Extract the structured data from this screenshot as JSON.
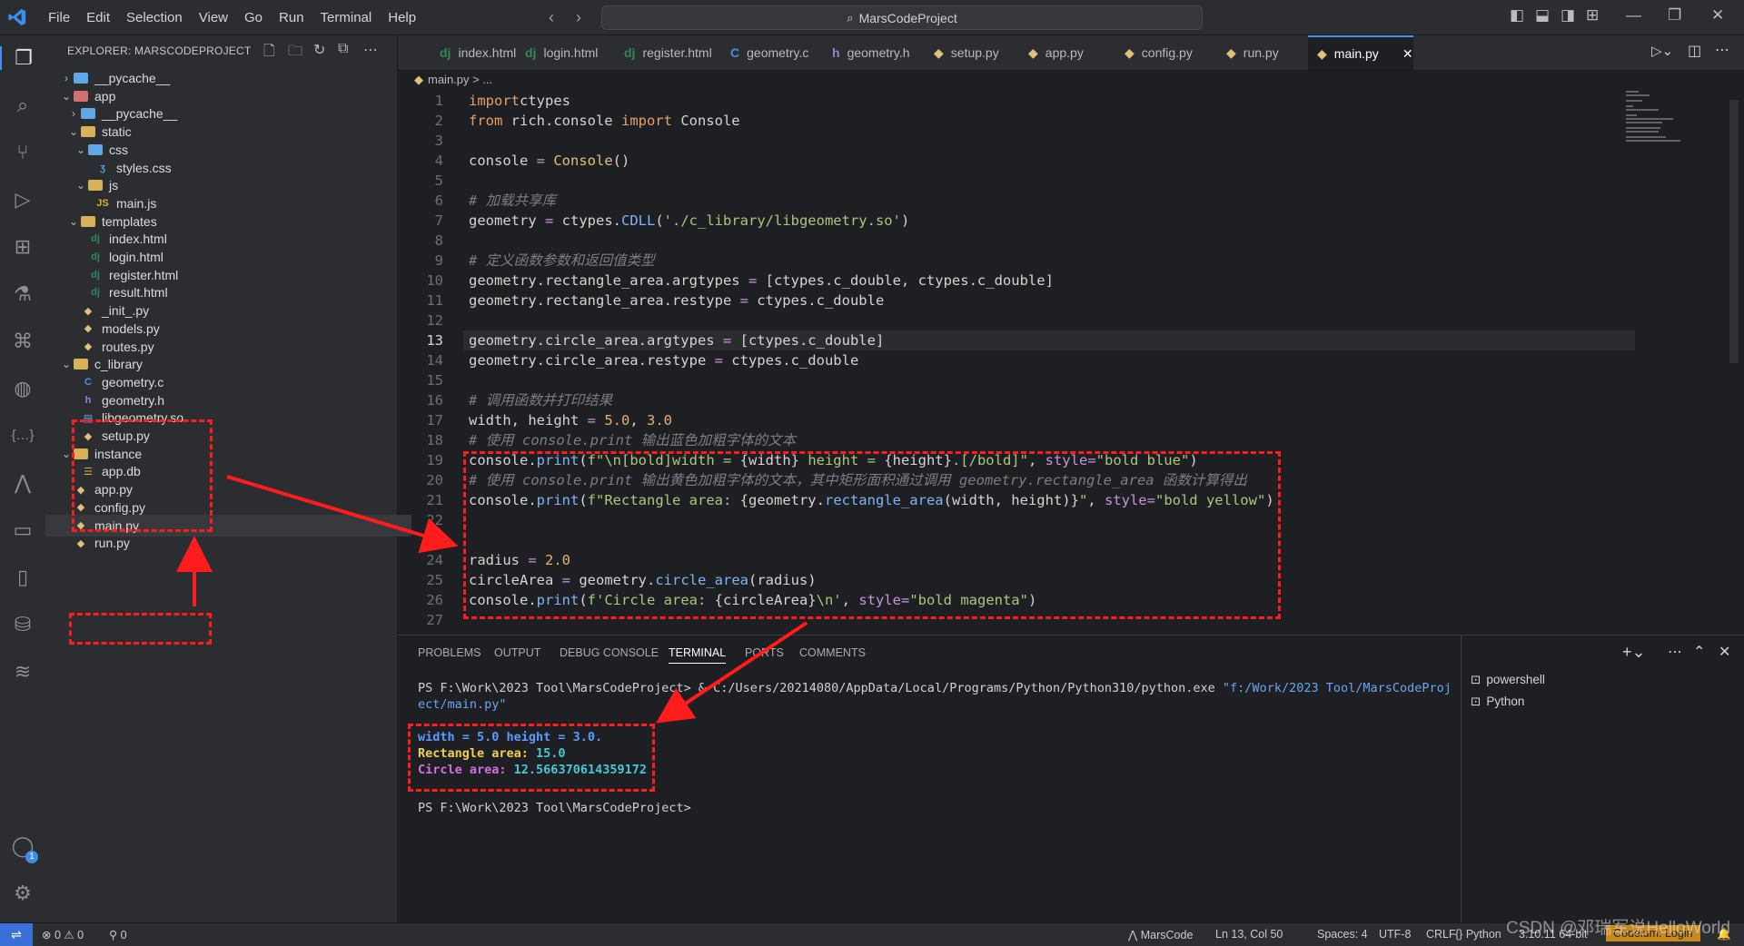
{
  "titlebar": {
    "menu": [
      "File",
      "Edit",
      "Selection",
      "View",
      "Go",
      "Run",
      "Terminal",
      "Help"
    ],
    "search": "MarsCodeProject"
  },
  "sidebar": {
    "title": "EXPLORER: MARSCODEPROJECT",
    "tree": [
      {
        "label": "__pycache__",
        "icon": "folder-blue",
        "chevron": "right"
      },
      {
        "label": "app",
        "icon": "folder-pink",
        "chevron": "down"
      },
      {
        "label": "__pycache__",
        "icon": "folder-blue",
        "chevron": "right"
      },
      {
        "label": "static",
        "icon": "folder",
        "chevron": "down"
      },
      {
        "label": "css",
        "icon": "folder-blue",
        "chevron": "down"
      },
      {
        "label": "styles.css",
        "icon": "css"
      },
      {
        "label": "js",
        "icon": "folder",
        "chevron": "down"
      },
      {
        "label": "main.js",
        "icon": "js"
      },
      {
        "label": "templates",
        "icon": "folder",
        "chevron": "down"
      },
      {
        "label": "index.html",
        "icon": "dj"
      },
      {
        "label": "login.html",
        "icon": "dj"
      },
      {
        "label": "register.html",
        "icon": "dj"
      },
      {
        "label": "result.html",
        "icon": "dj"
      },
      {
        "label": "_init_.py",
        "icon": "py"
      },
      {
        "label": "models.py",
        "icon": "py"
      },
      {
        "label": "routes.py",
        "icon": "py"
      },
      {
        "label": "c_library",
        "icon": "folder",
        "chevron": "down"
      },
      {
        "label": "geometry.c",
        "icon": "c"
      },
      {
        "label": "geometry.h",
        "icon": "h"
      },
      {
        "label": "libgeometry.so",
        "icon": "so"
      },
      {
        "label": "setup.py",
        "icon": "py"
      },
      {
        "label": "instance",
        "icon": "folder",
        "chevron": "down"
      },
      {
        "label": "app.db",
        "icon": "db"
      },
      {
        "label": "app.py",
        "icon": "py"
      },
      {
        "label": "config.py",
        "icon": "py"
      },
      {
        "label": "main.py",
        "icon": "py"
      },
      {
        "label": "run.py",
        "icon": "py"
      }
    ]
  },
  "tabs": [
    {
      "label": "index.html",
      "icon": "dj"
    },
    {
      "label": "login.html",
      "icon": "dj"
    },
    {
      "label": "register.html",
      "icon": "dj"
    },
    {
      "label": "geometry.c",
      "icon": "c"
    },
    {
      "label": "geometry.h",
      "icon": "h"
    },
    {
      "label": "setup.py",
      "icon": "py"
    },
    {
      "label": "app.py",
      "icon": "py"
    },
    {
      "label": "config.py",
      "icon": "py"
    },
    {
      "label": "run.py",
      "icon": "py"
    },
    {
      "label": "main.py",
      "icon": "py"
    }
  ],
  "breadcrumb": "main.py > ...",
  "code": [
    {
      "n": "1",
      "t": [
        [
          "kw",
          "import"
        ],
        [
          "",
          "ctypes"
        ]
      ]
    },
    {
      "n": "2",
      "t": [
        [
          "kw",
          "from"
        ],
        [
          "",
          " rich.console "
        ],
        [
          "kw",
          "import"
        ],
        [
          "",
          " Console"
        ]
      ]
    },
    {
      "n": "3",
      "t": []
    },
    {
      "n": "4",
      "t": [
        [
          "",
          "console "
        ],
        [
          "op",
          "="
        ],
        [
          "",
          " "
        ],
        [
          "cls",
          "Console"
        ],
        [
          "",
          "()"
        ]
      ]
    },
    {
      "n": "5",
      "t": []
    },
    {
      "n": "6",
      "t": [
        [
          "cm",
          "# 加载共享库"
        ]
      ]
    },
    {
      "n": "7",
      "t": [
        [
          "",
          "geometry "
        ],
        [
          "op",
          "="
        ],
        [
          "",
          " ctypes."
        ],
        [
          "fn",
          "CDLL"
        ],
        [
          "",
          "("
        ],
        [
          "str",
          "'./c_library/libgeometry.so'"
        ],
        [
          "",
          ")"
        ]
      ]
    },
    {
      "n": "8",
      "t": []
    },
    {
      "n": "9",
      "t": [
        [
          "cm",
          "# 定义函数参数和返回值类型"
        ]
      ]
    },
    {
      "n": "10",
      "t": [
        [
          "",
          "geometry.rectangle_area.argtypes "
        ],
        [
          "op",
          "="
        ],
        [
          "",
          " [ctypes.c_double, ctypes.c_double]"
        ]
      ]
    },
    {
      "n": "11",
      "t": [
        [
          "",
          "geometry.rectangle_area.restype "
        ],
        [
          "op",
          "="
        ],
        [
          "",
          " ctypes.c_double"
        ]
      ]
    },
    {
      "n": "12",
      "t": []
    },
    {
      "n": "13",
      "t": [
        [
          "",
          "geometry.circle_area.argtypes "
        ],
        [
          "op",
          "="
        ],
        [
          "",
          " [ctypes.c_double]"
        ]
      ],
      "cur": true
    },
    {
      "n": "14",
      "t": [
        [
          "",
          "geometry.circle_area.restype "
        ],
        [
          "op",
          "="
        ],
        [
          "",
          " ctypes.c_double"
        ]
      ]
    },
    {
      "n": "15",
      "t": []
    },
    {
      "n": "16",
      "t": [
        [
          "cm",
          "# 调用函数并打印结果"
        ]
      ]
    },
    {
      "n": "17",
      "t": [
        [
          "",
          "width, height "
        ],
        [
          "op",
          "="
        ],
        [
          "",
          " "
        ],
        [
          "num",
          "5.0"
        ],
        [
          "",
          ", "
        ],
        [
          "num",
          "3.0"
        ]
      ]
    },
    {
      "n": "18",
      "t": [
        [
          "cm",
          "# 使用 console.print 输出蓝色加粗字体的文本"
        ]
      ]
    },
    {
      "n": "19",
      "t": [
        [
          "",
          "console."
        ],
        [
          "fn",
          "print"
        ],
        [
          "",
          "("
        ],
        [
          "str",
          "f\"\\n[bold]width = "
        ],
        [
          "",
          "{width}"
        ],
        [
          "str",
          " height = "
        ],
        [
          "",
          "{height}"
        ],
        [
          "str",
          ".[/bold]\""
        ],
        [
          "",
          ", "
        ],
        [
          "op",
          "style"
        ],
        [
          "op",
          "="
        ],
        [
          "str",
          "\"bold blue\""
        ],
        [
          "",
          ")"
        ]
      ]
    },
    {
      "n": "20",
      "t": [
        [
          "cm",
          "# 使用 console.print 输出黄色加粗字体的文本，其中矩形面积通过调用 geometry.rectangle_area 函数计算得出"
        ]
      ]
    },
    {
      "n": "21",
      "t": [
        [
          "",
          "console."
        ],
        [
          "fn",
          "print"
        ],
        [
          "",
          "("
        ],
        [
          "str",
          "f\"Rectangle area: "
        ],
        [
          "",
          "{geometry."
        ],
        [
          "fn",
          "rectangle_area"
        ],
        [
          "",
          "(width, height)}"
        ],
        [
          "str",
          "\""
        ],
        [
          "",
          ", "
        ],
        [
          "op",
          "style"
        ],
        [
          "op",
          "="
        ],
        [
          "str",
          "\"bold yellow\""
        ],
        [
          "",
          ")"
        ]
      ]
    },
    {
      "n": "22",
      "t": []
    },
    {
      "n": "23",
      "t": []
    },
    {
      "n": "24",
      "t": [
        [
          "",
          "radius "
        ],
        [
          "op",
          "="
        ],
        [
          "",
          " "
        ],
        [
          "num",
          "2.0"
        ]
      ]
    },
    {
      "n": "25",
      "t": [
        [
          "",
          "circleArea "
        ],
        [
          "op",
          "="
        ],
        [
          "",
          " geometry."
        ],
        [
          "fn",
          "circle_area"
        ],
        [
          "",
          "(radius)"
        ]
      ]
    },
    {
      "n": "26",
      "t": [
        [
          "",
          "console."
        ],
        [
          "fn",
          "print"
        ],
        [
          "",
          "("
        ],
        [
          "str",
          "f'Circle area: "
        ],
        [
          "",
          "{circleArea}"
        ],
        [
          "str",
          "\\n'"
        ],
        [
          "",
          ", "
        ],
        [
          "op",
          "style"
        ],
        [
          "op",
          "="
        ],
        [
          "str",
          "\"bold magenta\""
        ],
        [
          "",
          ")"
        ]
      ]
    },
    {
      "n": "27",
      "t": []
    }
  ],
  "panel": {
    "tabs": [
      "PROBLEMS",
      "OUTPUT",
      "DEBUG CONSOLE",
      "TERMINAL",
      "PORTS",
      "COMMENTS"
    ],
    "active_tab": "TERMINAL",
    "terminal_cmd_1": "PS F:\\Work\\2023 Tool\\MarsCodeProject> & C:/Users/20214080/AppData/Local/Programs/Python/Python310/python.exe ",
    "terminal_cmd_path": "\"f:/Work/2023 Tool/MarsCodeProj",
    "terminal_cmd_2": "ect/main.py\"",
    "out_width": "width = 5.0 height = 3.0.",
    "out_rect_label": "Rectangle area: ",
    "out_rect_val": "15.0",
    "out_circle_label": "Circle area: ",
    "out_circle_val": "12.566370614359172",
    "prompt": "PS F:\\Work\\2023 Tool\\MarsCodeProject>",
    "terminals": [
      "powershell",
      "Python"
    ]
  },
  "statusbar": {
    "problems": "0",
    "warnings": "0",
    "ports": "0",
    "marscode": "MarsCode",
    "position": "Ln 13, Col 50",
    "spaces": "Spaces: 4",
    "encoding": "UTF-8",
    "eol": "CRLF",
    "language": "Python",
    "version": "3.10.11 64-bit",
    "codeium": "Codeium: Login"
  },
  "watermark": "CSDN @邓瑞军说HelloWorld",
  "colors": {
    "accent": "#4c8cf5",
    "annotation": "#ff1c1c",
    "term_blue": "#5b9bff",
    "term_yellow": "#f1d04a",
    "term_magenta": "#d46fe0",
    "term_cyan": "#46c9d6"
  }
}
